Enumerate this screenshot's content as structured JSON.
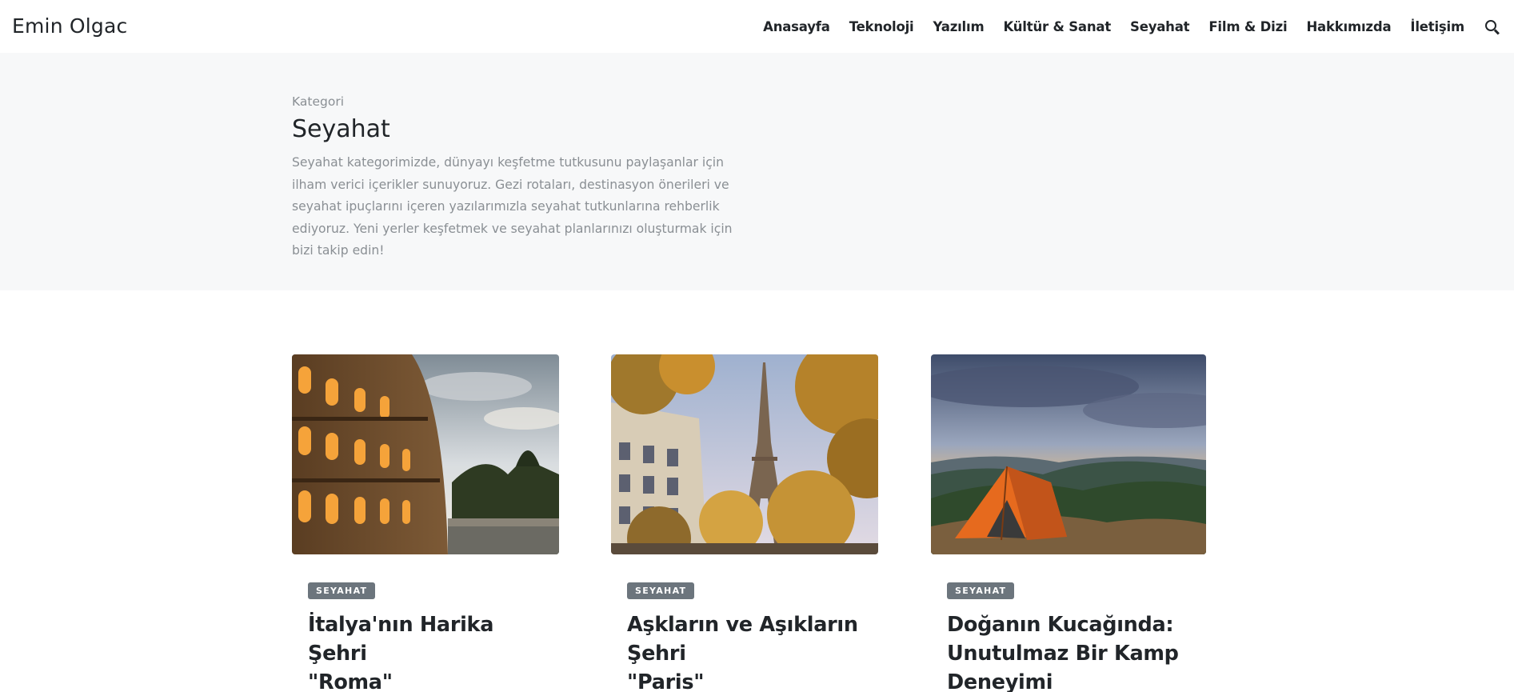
{
  "site": {
    "brand": "Emin Olgac"
  },
  "nav": {
    "items": [
      {
        "label": "Anasayfa",
        "name": "nav-anasayfa"
      },
      {
        "label": "Teknoloji",
        "name": "nav-teknoloji"
      },
      {
        "label": "Yazılım",
        "name": "nav-yazilim"
      },
      {
        "label": "Kültür & Sanat",
        "name": "nav-kultur-sanat"
      },
      {
        "label": "Seyahat",
        "name": "nav-seyahat"
      },
      {
        "label": "Film & Dizi",
        "name": "nav-film-dizi"
      },
      {
        "label": "Hakkımızda",
        "name": "nav-hakkimizda"
      },
      {
        "label": "İletişim",
        "name": "nav-iletisim"
      }
    ],
    "search_icon": "search-icon"
  },
  "hero": {
    "eyebrow": "Kategori",
    "title": "Seyahat",
    "description": "Seyahat kategorimizde, dünyayı keşfetme tutkusunu paylaşanlar için ilham verici içerikler sunuyoruz. Gezi rotaları, destinasyon önerileri ve seyahat ipuçlarını içeren yazılarımızla seyahat tutkunlarına rehberlik ediyoruz. Yeni yerler keşfetmek ve seyahat planlarınızı oluşturmak için bizi takip edin!"
  },
  "posts": [
    {
      "badge": "SEYAHAT",
      "title_line1": "İtalya'nın Harika Şehri",
      "title_line2": "\"Roma\"",
      "title_line3": "",
      "image": "colosseum-photo"
    },
    {
      "badge": "SEYAHAT",
      "title_line1": "Aşkların ve Aşıkların Şehri",
      "title_line2": "\"Paris\"",
      "title_line3": "",
      "image": "eiffel-tower-photo"
    },
    {
      "badge": "SEYAHAT",
      "title_line1": "Doğanın Kucağında:",
      "title_line2": "Unutulmaz Bir Kamp",
      "title_line3": "Deneyimi",
      "image": "camping-tent-photo"
    }
  ],
  "colors": {
    "hero_bg": "#f7f8f9",
    "badge_bg": "#6c757d",
    "text": "#212529",
    "muted": "#8a8f94"
  }
}
